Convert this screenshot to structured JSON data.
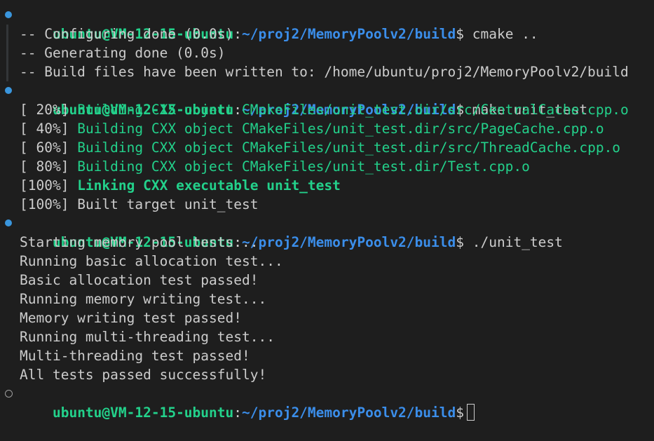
{
  "prompt": {
    "user_host": "ubuntu@VM-12-15-ubuntu",
    "colon": ":",
    "path": "~/proj2/MemoryPoolv2/build",
    "dollar": "$"
  },
  "blocks": [
    {
      "command": "cmake ..",
      "output": [
        "-- Configuring done (0.0s)",
        "-- Generating done (0.0s)",
        "-- Build files have been written to: /home/ubuntu/proj2/MemoryPoolv2/build"
      ]
    },
    {
      "command": "make unit_test",
      "build_lines": [
        {
          "pct": "[ 20%]",
          "text": "Building CXX object CMakeFiles/unit_test.dir/src/CentralCache.cpp.o"
        },
        {
          "pct": "[ 40%]",
          "text": "Building CXX object CMakeFiles/unit_test.dir/src/PageCache.cpp.o"
        },
        {
          "pct": "[ 60%]",
          "text": "Building CXX object CMakeFiles/unit_test.dir/src/ThreadCache.cpp.o"
        },
        {
          "pct": "[ 80%]",
          "text": "Building CXX object CMakeFiles/unit_test.dir/Test.cpp.o"
        },
        {
          "pct": "[100%]",
          "text": "Linking CXX executable unit_test"
        },
        {
          "pct": "[100%]",
          "text": "Built target unit_test"
        }
      ]
    },
    {
      "command": "./unit_test",
      "output": [
        "Starting memory pool tests...",
        "Running basic allocation test...",
        "Basic allocation test passed!",
        "Running memory writing test...",
        "Memory writing test passed!",
        "Running multi-threading test...",
        "Multi-threading test passed!",
        "All tests passed successfully!"
      ]
    }
  ],
  "colors": {
    "background": "#1e1e1e",
    "foreground": "#cccccc",
    "prompt_user": "#23d18b",
    "prompt_path": "#3b8eea",
    "build_green": "#23d18b",
    "marker_blue": "#3a96dd"
  }
}
